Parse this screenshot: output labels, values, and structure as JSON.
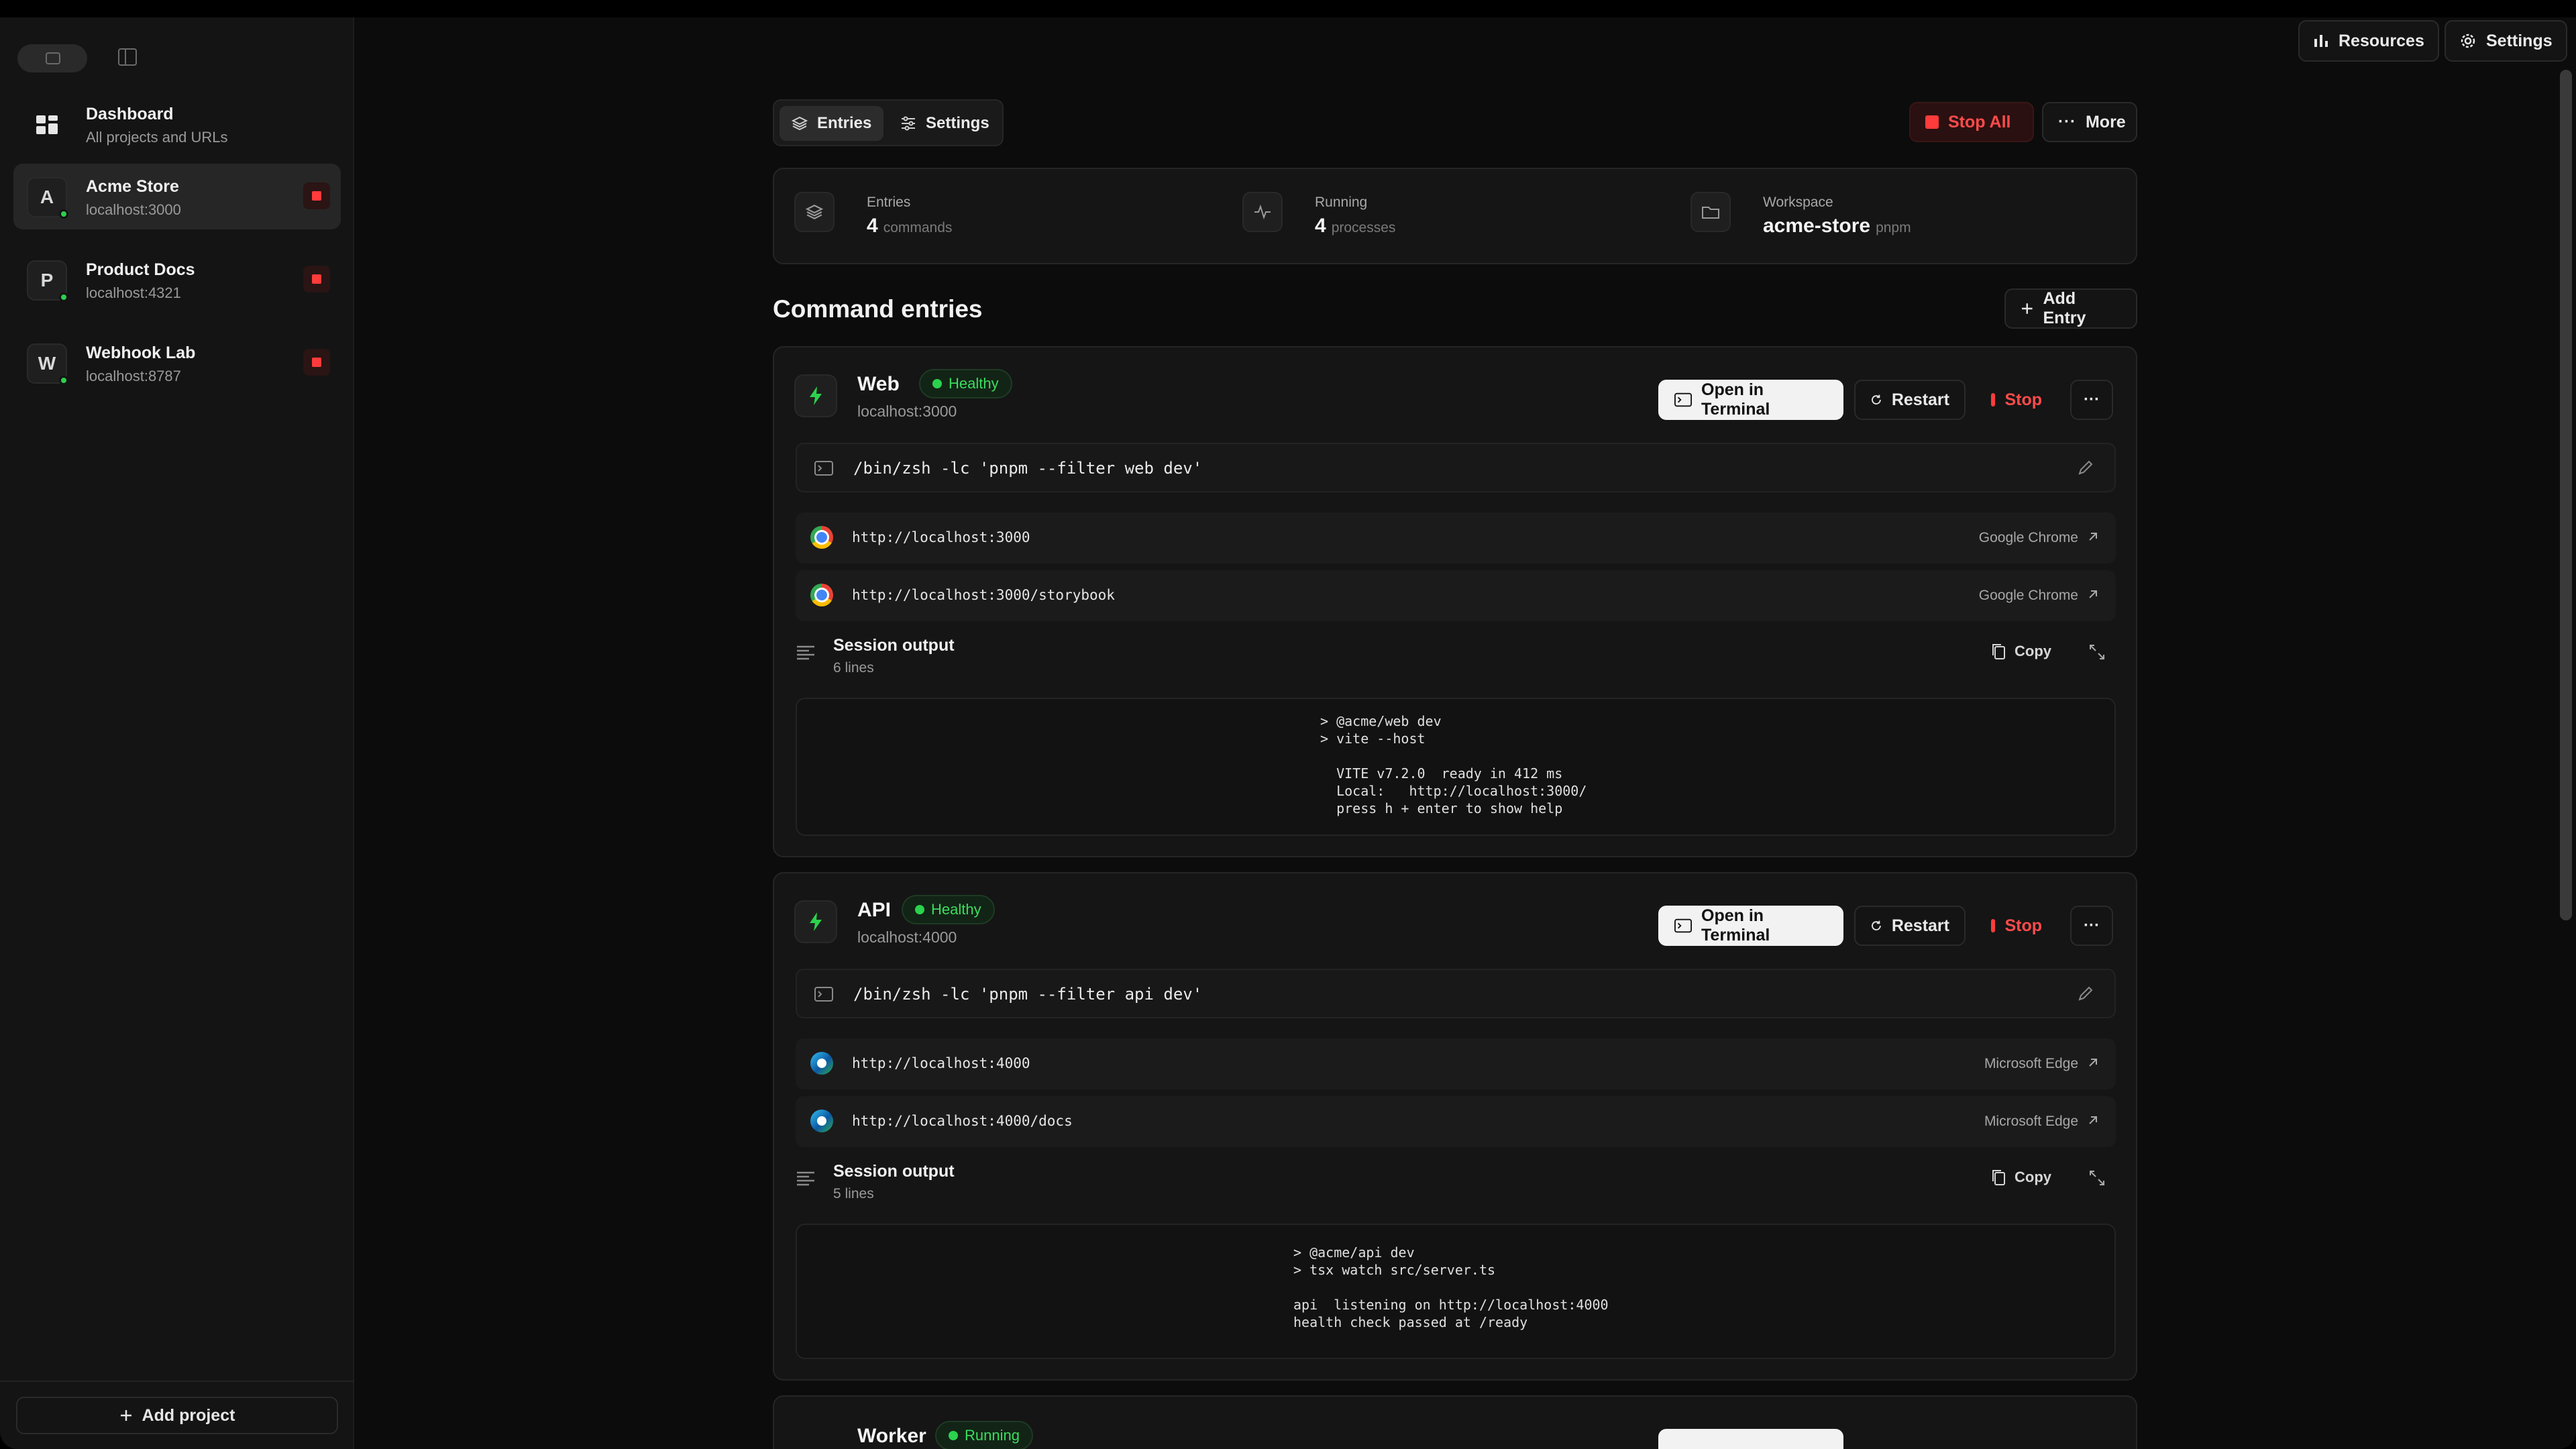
{
  "topbar": {
    "resources_label": "Resources",
    "settings_label": "Settings"
  },
  "sidebar": {
    "dashboard": {
      "title": "Dashboard",
      "subtitle": "All projects and URLs"
    },
    "projects": [
      {
        "initial": "A",
        "name": "Acme Store",
        "host": "localhost:3000",
        "active": true
      },
      {
        "initial": "P",
        "name": "Product Docs",
        "host": "localhost:4321",
        "active": false
      },
      {
        "initial": "W",
        "name": "Webhook Lab",
        "host": "localhost:8787",
        "active": false
      }
    ],
    "add_project_label": "Add project"
  },
  "tabs": [
    {
      "label": "Entries"
    },
    {
      "label": "Settings"
    }
  ],
  "actions": {
    "stop_all_label": "Stop All",
    "more_label": "More"
  },
  "summary": {
    "entries": {
      "label": "Entries",
      "value": "4",
      "unit": "commands"
    },
    "running": {
      "label": "Running",
      "value": "4",
      "unit": "processes"
    },
    "workspace": {
      "label": "Workspace",
      "value": "acme-store",
      "unit": "pnpm"
    }
  },
  "section": {
    "title": "Command entries",
    "add_entry_label": "Add Entry"
  },
  "entries": [
    {
      "name": "Web",
      "status": "Healthy",
      "host": "localhost:3000",
      "open_terminal_label": "Open in Terminal",
      "restart_label": "Restart",
      "stop_label": "Stop",
      "command": "/bin/zsh -lc 'pnpm --filter web dev'",
      "urls": [
        {
          "url": "http://localhost:3000",
          "browser": "Google Chrome",
          "icon": "chrome"
        },
        {
          "url": "http://localhost:3000/storybook",
          "browser": "Google Chrome",
          "icon": "chrome"
        }
      ],
      "session": {
        "title": "Session output",
        "count": "6 lines",
        "copy_label": "Copy",
        "output": "> @acme/web dev\n> vite --host\n\n  VITE v7.2.0  ready in 412 ms\n  Local:   http://localhost:3000/\n  press h + enter to show help"
      }
    },
    {
      "name": "API",
      "status": "Healthy",
      "host": "localhost:4000",
      "open_terminal_label": "Open in Terminal",
      "restart_label": "Restart",
      "stop_label": "Stop",
      "command": "/bin/zsh -lc 'pnpm --filter api dev'",
      "urls": [
        {
          "url": "http://localhost:4000",
          "browser": "Microsoft Edge",
          "icon": "edge"
        },
        {
          "url": "http://localhost:4000/docs",
          "browser": "Microsoft Edge",
          "icon": "edge"
        }
      ],
      "session": {
        "title": "Session output",
        "count": "5 lines",
        "copy_label": "Copy",
        "output": "> @acme/api dev\n> tsx watch src/server.ts\n\napi  listening on http://localhost:4000\nhealth check passed at /ready"
      }
    },
    {
      "name": "Worker",
      "status": "Running"
    }
  ],
  "colors": {
    "accent_green": "#2bd24d",
    "danger_red": "#ff3b3b",
    "background": "#0c0c0c"
  }
}
